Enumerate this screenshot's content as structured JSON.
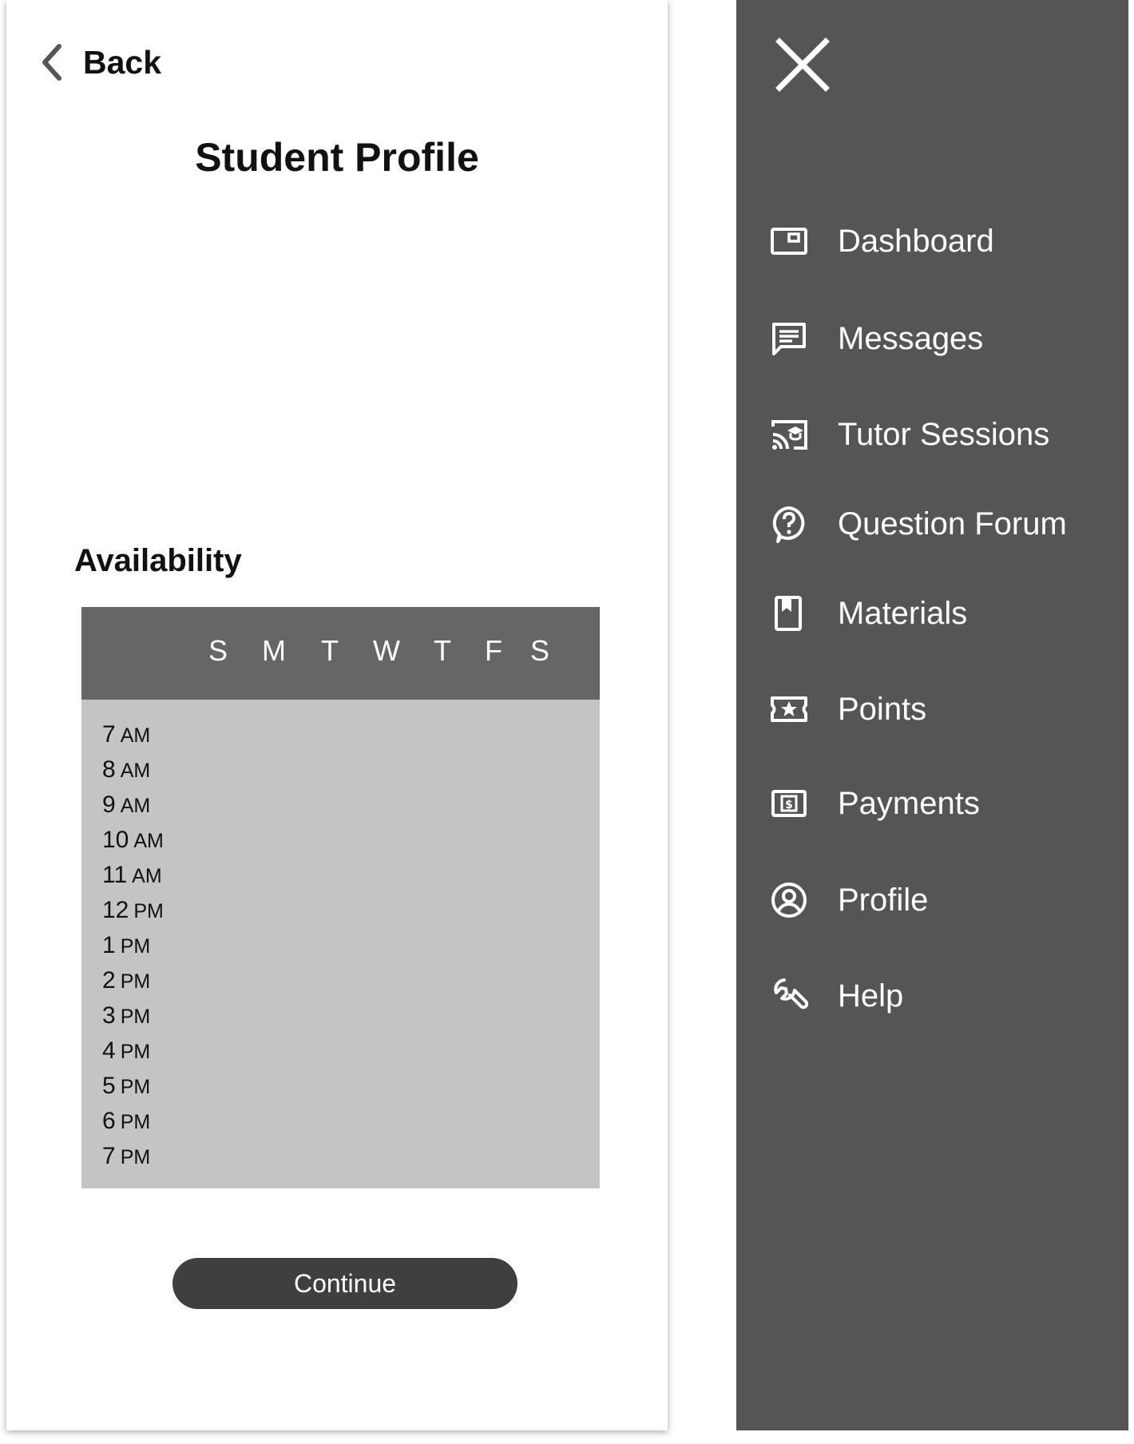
{
  "header": {
    "back_label": "Back",
    "title": "Student Profile"
  },
  "availability": {
    "title": "Availability",
    "days": [
      "S",
      "M",
      "T",
      "W",
      "T",
      "F",
      "S"
    ],
    "times": [
      {
        "hour": "7",
        "period": "AM"
      },
      {
        "hour": "8",
        "period": "AM"
      },
      {
        "hour": "9",
        "period": "AM"
      },
      {
        "hour": "10",
        "period": "AM"
      },
      {
        "hour": "11",
        "period": "AM"
      },
      {
        "hour": "12",
        "period": "PM"
      },
      {
        "hour": "1",
        "period": "PM"
      },
      {
        "hour": "2",
        "period": "PM"
      },
      {
        "hour": "3",
        "period": "PM"
      },
      {
        "hour": "4",
        "period": "PM"
      },
      {
        "hour": "5",
        "period": "PM"
      },
      {
        "hour": "6",
        "period": "PM"
      },
      {
        "hour": "7",
        "period": "PM"
      }
    ]
  },
  "actions": {
    "continue_label": "Continue"
  },
  "nav_menu": {
    "close_icon": "close-icon",
    "items": [
      {
        "label": "Dashboard",
        "icon": "dashboard-icon"
      },
      {
        "label": "Messages",
        "icon": "messages-icon"
      },
      {
        "label": "Tutor Sessions",
        "icon": "tutor-sessions-icon"
      },
      {
        "label": "Question Forum",
        "icon": "question-forum-icon"
      },
      {
        "label": "Materials",
        "icon": "materials-icon"
      },
      {
        "label": "Points",
        "icon": "points-icon"
      },
      {
        "label": "Payments",
        "icon": "payments-icon"
      },
      {
        "label": "Profile",
        "icon": "profile-icon"
      },
      {
        "label": "Help",
        "icon": "help-icon"
      }
    ]
  },
  "colors": {
    "menu_background": "#555555",
    "grid_header": "#666666",
    "grid_body": "#c4c4c4",
    "button": "#3f3f3f"
  }
}
